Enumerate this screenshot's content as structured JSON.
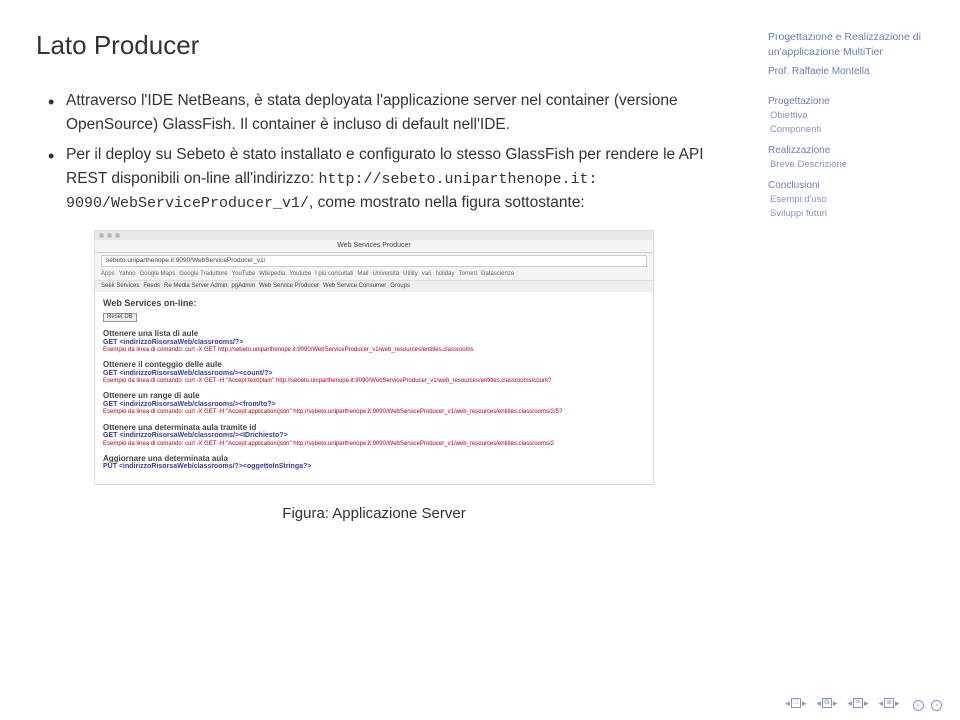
{
  "title": "Lato Producer",
  "bullets": [
    {
      "text": "Attraverso l'IDE NetBeans, è stata deployata l'applicazione server nel container (versione OpenSource) GlassFish. Il container è incluso di default nell'IDE."
    },
    {
      "pre": "Per il deploy su Sebeto è stato installato e configurato lo stesso GlassFish per rendere le API REST disponibili on-line all'indirizzo: ",
      "code1": "http://sebeto.uniparthenope.it:",
      "code2": "9090/WebServiceProducer_v1/",
      "post": ", come mostrato nella figura sottostante:"
    }
  ],
  "figure": {
    "caption": "Figura: Applicazione Server",
    "tabtitle": "Web Services Producer",
    "url": "sebeto.uniparthenope.it:9090/WebServiceProducer_v1/",
    "bookmarks": [
      "Apps",
      "Yahoo",
      "Google Maps",
      "Google Traduttore",
      "YouTube",
      "Wikipedia",
      "Youtube",
      "I più consultati",
      "Mail",
      "Università",
      "Utility",
      "vari",
      "holiday",
      "Torrent",
      "Datascienze"
    ],
    "nav": [
      "Seek Services",
      "Feeds",
      "Re Media Server Admin",
      "pgAdmin",
      "Web Service Producer",
      "Web Service Consumer",
      "Groups"
    ],
    "heading": "Web Services on-line:",
    "reset": "Reset DB",
    "endpoints": [
      {
        "title": "Ottenere una lista di aule",
        "get": "GET <indirizzoRisorsaWeb/classrooms/?>",
        "cmd": "Esempio da linea di comando: curl -X GET http://sebeto.uniparthenope.it:9090/WebServiceProducer_v1/web_resources/entities.classrooms"
      },
      {
        "title": "Ottenere il conteggio delle aule",
        "get": "GET <indirizzoRisorsaWeb/classrooms/><count/?>",
        "cmd": "Esempio da linea di comando: curl -X GET -H \"Accept:text/plain\" http://sebeto.uniparthenope.it:9090/WebServiceProducer_v1/web_resources/entities.classrooms/count?"
      },
      {
        "title": "Ottenere un range di aule",
        "get": "GET <indirizzoRisorsaWeb/classrooms/><from/to?>",
        "cmd": "Esempio da linea di comando: curl -X GET -H \"Accept:application/json\" http://sebeto.uniparthenope.it:9090/WebServiceProducer_v1/web_resources/entities.classrooms/2/5?"
      },
      {
        "title": "Ottenere una determinata aula tramite id",
        "get": "GET <indirizzoRisorsaWeb/classrooms/><IDrichiesto?>",
        "cmd": "Esempio da linea di comando: curl -X GET -H \"Accept:application/json\" http://sebeto.uniparthenope.it:9090/WebServiceProducer_v1/web_resources/entities.classrooms/2"
      },
      {
        "title": "Aggiornare una determinata aula",
        "get": "PUT <indirizzoRisorsaWeb/classrooms/?><oggettoInStringa?>",
        "cmd": ""
      }
    ]
  },
  "sidebar": {
    "title": "Progettazione e Realizzazione di un'applicazione MultiTier",
    "author": "Prof. Raffaele Montella",
    "sections": [
      {
        "label": "Progettazione",
        "subs": [
          "Obiettivo",
          "Componenti"
        ]
      },
      {
        "label": "Realizzazione",
        "subs": [
          "Breve Descrizione"
        ]
      },
      {
        "label": "Conclusioni",
        "subs": [
          "Esempi d'uso",
          "Sviluppi futuri"
        ]
      }
    ]
  }
}
